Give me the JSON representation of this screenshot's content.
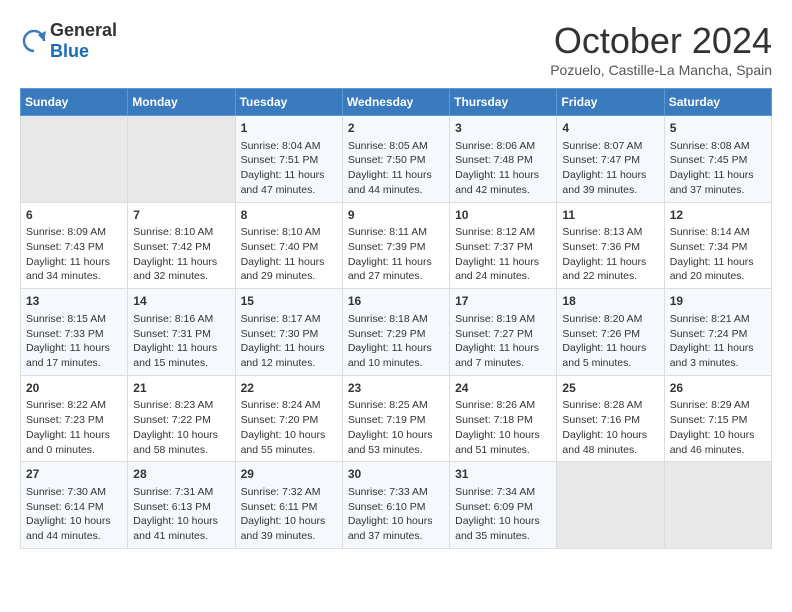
{
  "header": {
    "logo_general": "General",
    "logo_blue": "Blue",
    "month_year": "October 2024",
    "location": "Pozuelo, Castille-La Mancha, Spain"
  },
  "days_of_week": [
    "Sunday",
    "Monday",
    "Tuesday",
    "Wednesday",
    "Thursday",
    "Friday",
    "Saturday"
  ],
  "weeks": [
    [
      {
        "day": "",
        "content": ""
      },
      {
        "day": "",
        "content": ""
      },
      {
        "day": "1",
        "content": "Sunrise: 8:04 AM\nSunset: 7:51 PM\nDaylight: 11 hours and 47 minutes."
      },
      {
        "day": "2",
        "content": "Sunrise: 8:05 AM\nSunset: 7:50 PM\nDaylight: 11 hours and 44 minutes."
      },
      {
        "day": "3",
        "content": "Sunrise: 8:06 AM\nSunset: 7:48 PM\nDaylight: 11 hours and 42 minutes."
      },
      {
        "day": "4",
        "content": "Sunrise: 8:07 AM\nSunset: 7:47 PM\nDaylight: 11 hours and 39 minutes."
      },
      {
        "day": "5",
        "content": "Sunrise: 8:08 AM\nSunset: 7:45 PM\nDaylight: 11 hours and 37 minutes."
      }
    ],
    [
      {
        "day": "6",
        "content": "Sunrise: 8:09 AM\nSunset: 7:43 PM\nDaylight: 11 hours and 34 minutes."
      },
      {
        "day": "7",
        "content": "Sunrise: 8:10 AM\nSunset: 7:42 PM\nDaylight: 11 hours and 32 minutes."
      },
      {
        "day": "8",
        "content": "Sunrise: 8:10 AM\nSunset: 7:40 PM\nDaylight: 11 hours and 29 minutes."
      },
      {
        "day": "9",
        "content": "Sunrise: 8:11 AM\nSunset: 7:39 PM\nDaylight: 11 hours and 27 minutes."
      },
      {
        "day": "10",
        "content": "Sunrise: 8:12 AM\nSunset: 7:37 PM\nDaylight: 11 hours and 24 minutes."
      },
      {
        "day": "11",
        "content": "Sunrise: 8:13 AM\nSunset: 7:36 PM\nDaylight: 11 hours and 22 minutes."
      },
      {
        "day": "12",
        "content": "Sunrise: 8:14 AM\nSunset: 7:34 PM\nDaylight: 11 hours and 20 minutes."
      }
    ],
    [
      {
        "day": "13",
        "content": "Sunrise: 8:15 AM\nSunset: 7:33 PM\nDaylight: 11 hours and 17 minutes."
      },
      {
        "day": "14",
        "content": "Sunrise: 8:16 AM\nSunset: 7:31 PM\nDaylight: 11 hours and 15 minutes."
      },
      {
        "day": "15",
        "content": "Sunrise: 8:17 AM\nSunset: 7:30 PM\nDaylight: 11 hours and 12 minutes."
      },
      {
        "day": "16",
        "content": "Sunrise: 8:18 AM\nSunset: 7:29 PM\nDaylight: 11 hours and 10 minutes."
      },
      {
        "day": "17",
        "content": "Sunrise: 8:19 AM\nSunset: 7:27 PM\nDaylight: 11 hours and 7 minutes."
      },
      {
        "day": "18",
        "content": "Sunrise: 8:20 AM\nSunset: 7:26 PM\nDaylight: 11 hours and 5 minutes."
      },
      {
        "day": "19",
        "content": "Sunrise: 8:21 AM\nSunset: 7:24 PM\nDaylight: 11 hours and 3 minutes."
      }
    ],
    [
      {
        "day": "20",
        "content": "Sunrise: 8:22 AM\nSunset: 7:23 PM\nDaylight: 11 hours and 0 minutes."
      },
      {
        "day": "21",
        "content": "Sunrise: 8:23 AM\nSunset: 7:22 PM\nDaylight: 10 hours and 58 minutes."
      },
      {
        "day": "22",
        "content": "Sunrise: 8:24 AM\nSunset: 7:20 PM\nDaylight: 10 hours and 55 minutes."
      },
      {
        "day": "23",
        "content": "Sunrise: 8:25 AM\nSunset: 7:19 PM\nDaylight: 10 hours and 53 minutes."
      },
      {
        "day": "24",
        "content": "Sunrise: 8:26 AM\nSunset: 7:18 PM\nDaylight: 10 hours and 51 minutes."
      },
      {
        "day": "25",
        "content": "Sunrise: 8:28 AM\nSunset: 7:16 PM\nDaylight: 10 hours and 48 minutes."
      },
      {
        "day": "26",
        "content": "Sunrise: 8:29 AM\nSunset: 7:15 PM\nDaylight: 10 hours and 46 minutes."
      }
    ],
    [
      {
        "day": "27",
        "content": "Sunrise: 7:30 AM\nSunset: 6:14 PM\nDaylight: 10 hours and 44 minutes."
      },
      {
        "day": "28",
        "content": "Sunrise: 7:31 AM\nSunset: 6:13 PM\nDaylight: 10 hours and 41 minutes."
      },
      {
        "day": "29",
        "content": "Sunrise: 7:32 AM\nSunset: 6:11 PM\nDaylight: 10 hours and 39 minutes."
      },
      {
        "day": "30",
        "content": "Sunrise: 7:33 AM\nSunset: 6:10 PM\nDaylight: 10 hours and 37 minutes."
      },
      {
        "day": "31",
        "content": "Sunrise: 7:34 AM\nSunset: 6:09 PM\nDaylight: 10 hours and 35 minutes."
      },
      {
        "day": "",
        "content": ""
      },
      {
        "day": "",
        "content": ""
      }
    ]
  ]
}
